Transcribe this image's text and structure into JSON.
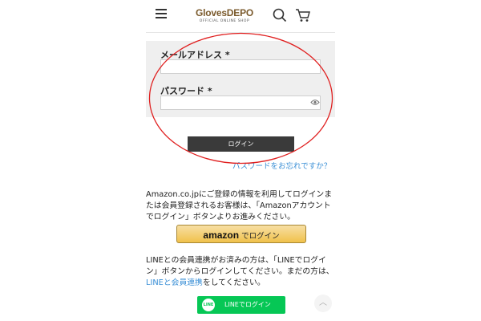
{
  "header": {
    "brand": "GlovesDEPO",
    "brand_sub": "OFFICIAL ONLINE SHOP",
    "menu_icon": "hamburger-icon",
    "search_icon": "search-icon",
    "cart_icon": "cart-icon"
  },
  "form": {
    "email_label": "メールアドレス *",
    "email_value": "",
    "password_label": "パスワード *",
    "password_value": "",
    "login_button": "ログイン",
    "forgot_link": "パスワードをお忘れですか？"
  },
  "amazon": {
    "text": "Amazon.co.jpにご登録の情報を利用してログインまたは会員登録されるお客様は、「Amazonアカウントでログイン」ボタンよりお進みください。",
    "button_logo": "amazon",
    "button_text": "でログイン"
  },
  "line": {
    "text_before": "LINEとの会員連携がお済みの方は、「LINEでログイン」ボタンからログインしてください。まだの方は、",
    "link_text": "LINEと会員連携",
    "text_after": "をしてください。",
    "button_icon_text": "LINE",
    "button_text": "LINEでログイン"
  },
  "colors": {
    "annotation_circle": "#e02020",
    "link": "#3a8fd6",
    "line_green": "#06c755",
    "amazon_yellow": "#f0c14b"
  }
}
